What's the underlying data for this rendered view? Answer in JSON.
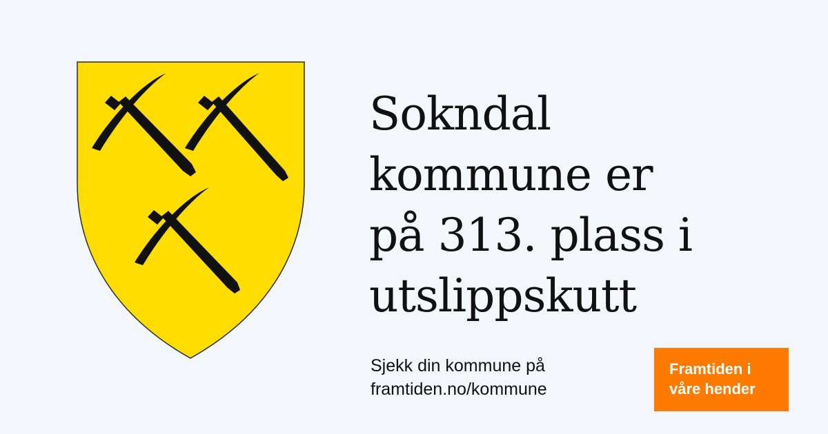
{
  "emblem": {
    "name": "coat-of-arms-icon",
    "shield_color": "#ffdd00",
    "charge_color": "#111111",
    "charge_icon": "pickaxe-icon",
    "charge_count": 3
  },
  "headline": {
    "lines": [
      "Sokndal",
      "kommune er",
      "på 313. plass i",
      "utslippskutt"
    ]
  },
  "cta": {
    "lines": [
      "Sjekk din kommune på",
      "framtiden.no/kommune"
    ]
  },
  "badge": {
    "lines": [
      "Framtiden i",
      "våre hender"
    ],
    "color": "#ff7a00"
  },
  "colors": {
    "background": "#f3f6fa",
    "text": "#111111"
  }
}
